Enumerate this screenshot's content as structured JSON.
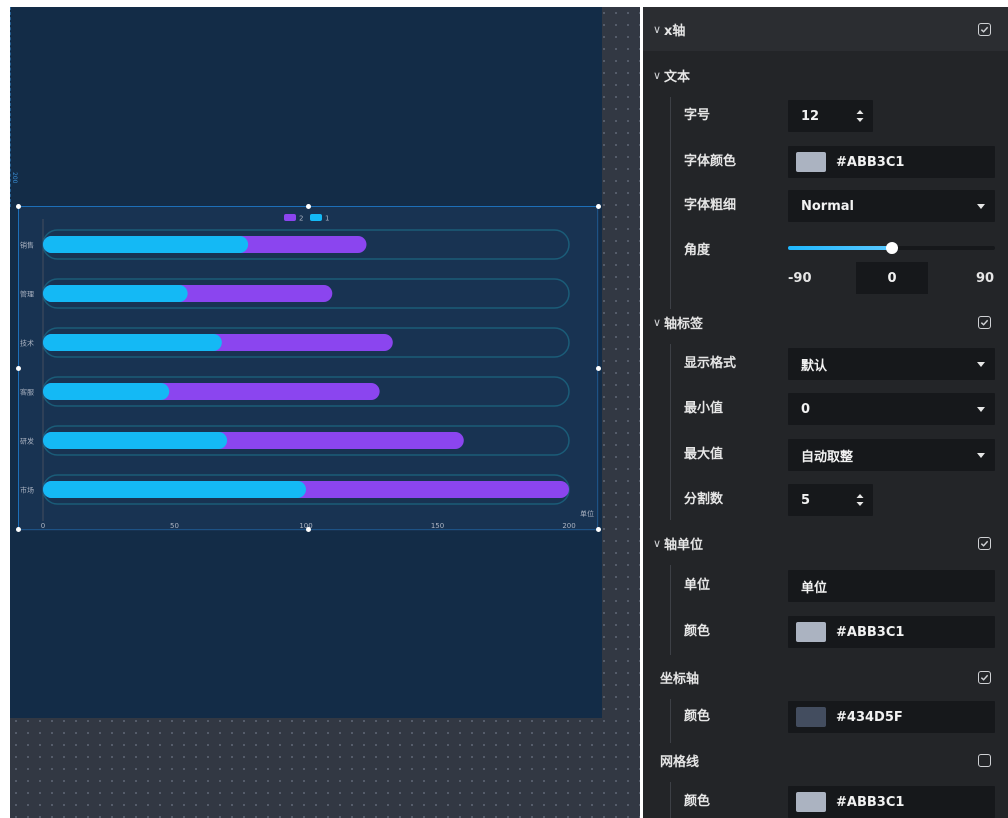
{
  "chart_data": {
    "type": "bar",
    "stacked": true,
    "orientation": "horizontal",
    "categories": [
      "市场",
      "研发",
      "客服",
      "技术",
      "管理",
      "销售"
    ],
    "series": [
      {
        "name": "1",
        "values": [
          100,
          70,
          48,
          68,
          55,
          78
        ],
        "color": "#14b9f5"
      },
      {
        "name": "2",
        "values": [
          100,
          90,
          80,
          65,
          55,
          45
        ],
        "color": "#8b45ef"
      }
    ],
    "xlim": [
      0,
      200
    ],
    "xticks": [
      "0",
      "50",
      "100",
      "150",
      "200"
    ],
    "unit_label": "单位",
    "legend": "top-center",
    "grid": false
  },
  "ruler_label": "200",
  "panel": {
    "x_axis": {
      "title": "x轴",
      "checked": true
    },
    "text": {
      "title": "文本",
      "font_size": {
        "label": "字号",
        "value": "12"
      },
      "font_color": {
        "label": "字体颜色",
        "value": "#ABB3C1",
        "swatch": "#ABB3C1"
      },
      "font_weight": {
        "label": "字体粗细",
        "value": "Normal"
      },
      "angle": {
        "label": "角度",
        "min": "-90",
        "max": "90",
        "value": "0",
        "fraction": 0.5
      }
    },
    "axis_label": {
      "title": "轴标签",
      "checked": true,
      "format": {
        "label": "显示格式",
        "value": "默认"
      },
      "min": {
        "label": "最小值",
        "value": "0"
      },
      "max": {
        "label": "最大值",
        "value": "自动取整"
      },
      "splits": {
        "label": "分割数",
        "value": "5"
      }
    },
    "axis_unit": {
      "title": "轴单位",
      "checked": true,
      "unit": {
        "label": "单位",
        "value": "单位"
      },
      "color": {
        "label": "颜色",
        "value": "#ABB3C1",
        "swatch": "#ABB3C1"
      }
    },
    "axis_line": {
      "title": "坐标轴",
      "checked": true,
      "color": {
        "label": "颜色",
        "value": "#434D5F",
        "swatch": "#434D5F"
      }
    },
    "grid_line": {
      "title": "网格线",
      "checked": false,
      "color": {
        "label": "颜色",
        "value": "#ABB3C1",
        "swatch": "#ABB3C1"
      }
    }
  }
}
